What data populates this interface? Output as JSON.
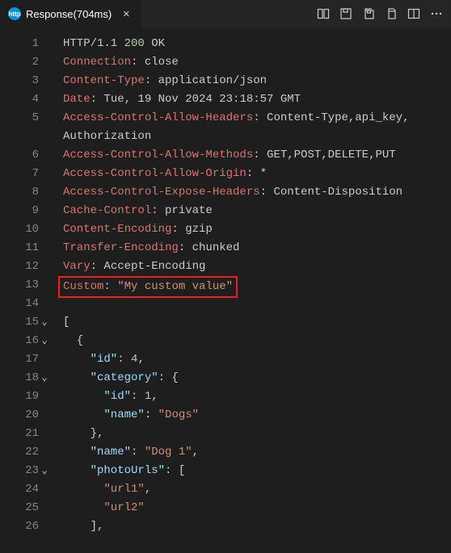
{
  "tab": {
    "icon_label": "http",
    "title": "Response(704ms)",
    "close": "×"
  },
  "lines": {
    "l1_a": "HTTP/1.1 ",
    "l1_b": "200",
    "l1_c": " OK",
    "l2_k": "Connection",
    "l2_v": ": close",
    "l3_k": "Content-Type",
    "l3_v": ": application/json",
    "l4_k": "Date",
    "l4_v": ": Tue, 19 Nov 2024 23:18:57 GMT",
    "l5_k": "Access-Control-Allow-Headers",
    "l5_v": ": Content-Type,api_key,",
    "l5b": "Authorization",
    "l6_k": "Access-Control-Allow-Methods",
    "l6_v": ": GET,POST,DELETE,PUT",
    "l7_k": "Access-Control-Allow-Origin",
    "l7_v": ": *",
    "l8_k": "Access-Control-Expose-Headers",
    "l8_v": ": Content-Disposition",
    "l9_k": "Cache-Control",
    "l9_v": ": private",
    "l10_k": "Content-Encoding",
    "l10_v": ": gzip",
    "l11_k": "Transfer-Encoding",
    "l11_v": ": chunked",
    "l12_k": "Vary",
    "l12_v": ": Accept-Encoding",
    "l13_k": "Custom",
    "l13_c": ": ",
    "l13_v": "\"My custom value\"",
    "l15": "[",
    "l16": "  {",
    "l17_k": "    \"id\"",
    "l17_c": ": ",
    "l17_v": "4",
    "l17_e": ",",
    "l18_k": "    \"category\"",
    "l18_c": ": {",
    "l19_k": "      \"id\"",
    "l19_c": ": ",
    "l19_v": "1",
    "l19_e": ",",
    "l20_k": "      \"name\"",
    "l20_c": ": ",
    "l20_v": "\"Dogs\"",
    "l21": "    },",
    "l22_k": "    \"name\"",
    "l22_c": ": ",
    "l22_v": "\"Dog 1\"",
    "l22_e": ",",
    "l23_k": "    \"photoUrls\"",
    "l23_c": ": [",
    "l24_v": "      \"url1\"",
    "l24_e": ",",
    "l25_v": "      \"url2\"",
    "l26": "    ],"
  },
  "nums": {
    "n1": "1",
    "n2": "2",
    "n3": "3",
    "n4": "4",
    "n5": "5",
    "n6": "6",
    "n7": "7",
    "n8": "8",
    "n9": "9",
    "n10": "10",
    "n11": "11",
    "n12": "12",
    "n13": "13",
    "n14": "14",
    "n15": "15",
    "n16": "16",
    "n17": "17",
    "n18": "18",
    "n19": "19",
    "n20": "20",
    "n21": "21",
    "n22": "22",
    "n23": "23",
    "n24": "24",
    "n25": "25",
    "n26": "26"
  },
  "fold": "⌄"
}
